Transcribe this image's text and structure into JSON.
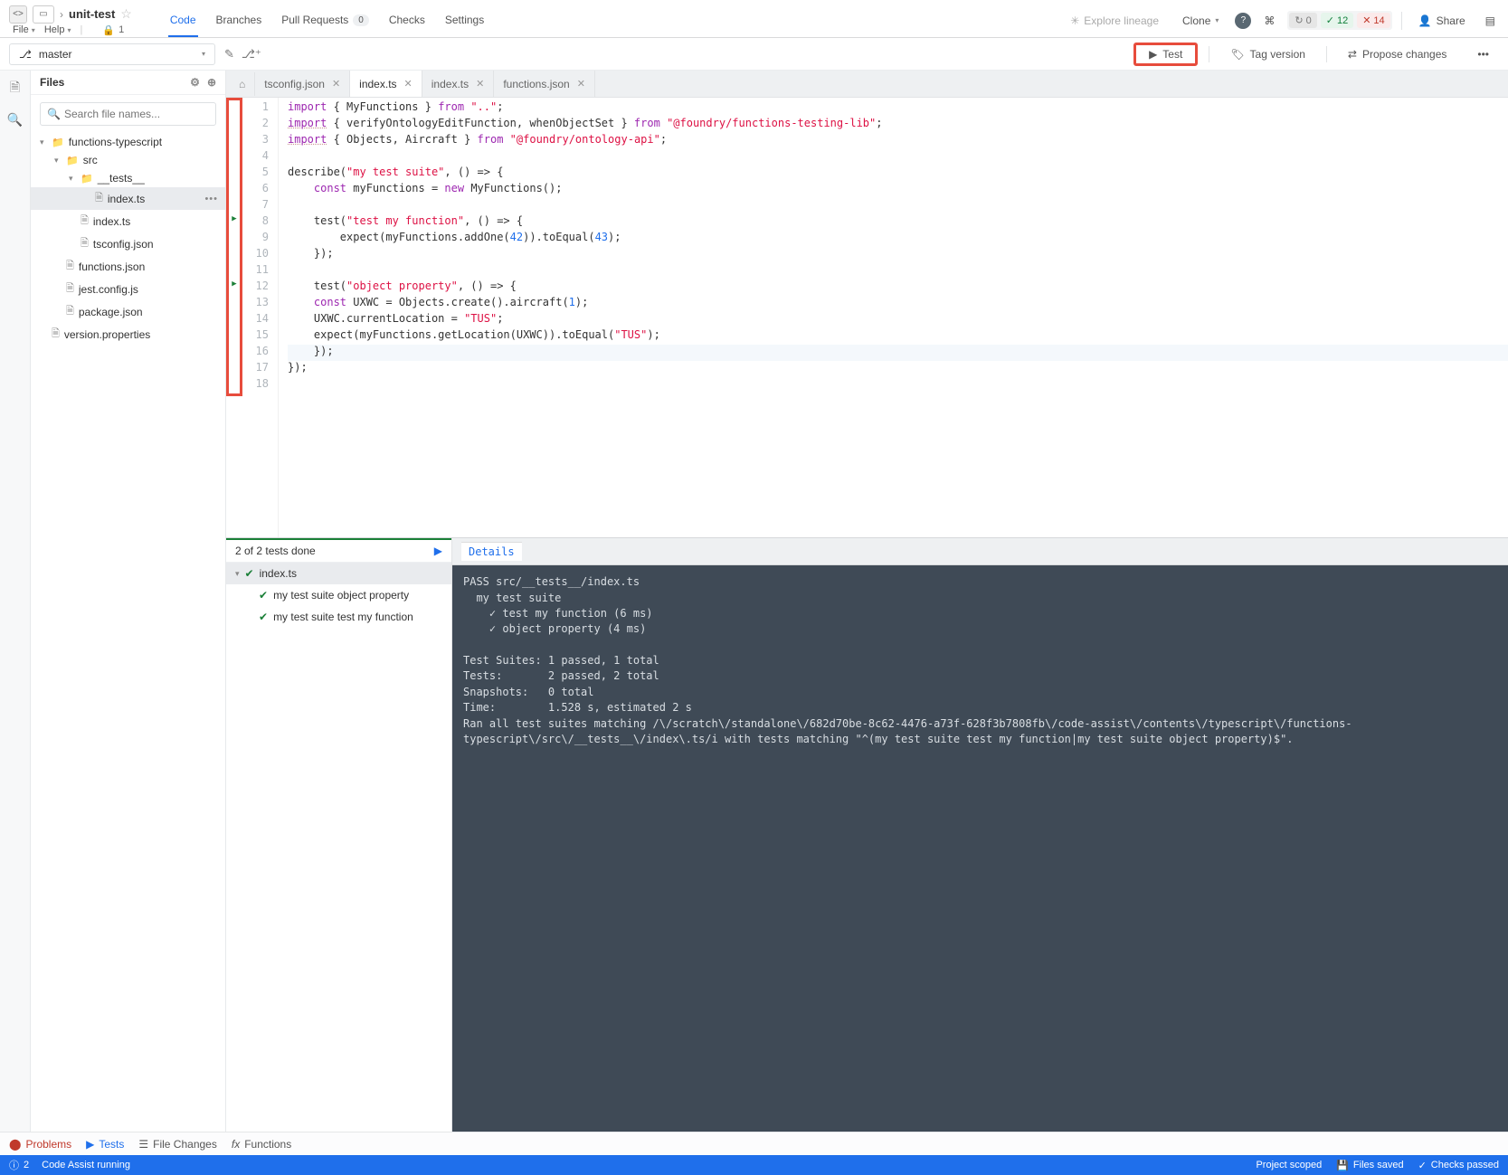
{
  "header": {
    "breadcrumb_prefix": "> ",
    "title": "unit-test",
    "file_menu": "File",
    "help_menu": "Help",
    "lock_owner": "1",
    "nav": {
      "code": "Code",
      "branches": "Branches",
      "pull_requests": "Pull Requests",
      "pr_count": "0",
      "checks": "Checks",
      "settings": "Settings"
    },
    "right": {
      "explore": "Explore lineage",
      "clone": "Clone",
      "stat_sync": "0",
      "stat_pass": "12",
      "stat_fail": "14",
      "share": "Share"
    }
  },
  "subheader": {
    "branch": "master",
    "test": "Test",
    "tag_version": "Tag version",
    "propose": "Propose changes"
  },
  "sidebar": {
    "title": "Files",
    "search_placeholder": "Search file names...",
    "tree": [
      {
        "depth": 0,
        "type": "folder",
        "open": true,
        "name": "functions-typescript"
      },
      {
        "depth": 1,
        "type": "folder",
        "open": true,
        "name": "src"
      },
      {
        "depth": 2,
        "type": "folder",
        "open": true,
        "name": "__tests__"
      },
      {
        "depth": 3,
        "type": "file",
        "name": "index.ts",
        "selected": true
      },
      {
        "depth": 2,
        "type": "file",
        "name": "index.ts"
      },
      {
        "depth": 2,
        "type": "file",
        "name": "tsconfig.json"
      },
      {
        "depth": 1,
        "type": "file",
        "name": "functions.json"
      },
      {
        "depth": 1,
        "type": "file",
        "name": "jest.config.js"
      },
      {
        "depth": 1,
        "type": "file",
        "name": "package.json"
      },
      {
        "depth": 0,
        "type": "file",
        "name": "version.properties"
      }
    ]
  },
  "tabs": [
    {
      "name": "tsconfig.json",
      "active": false
    },
    {
      "name": "index.ts",
      "active": true
    },
    {
      "name": "index.ts",
      "active": false
    },
    {
      "name": "functions.json",
      "active": false
    }
  ],
  "code": {
    "lines": [
      {
        "n": 1,
        "html": "<span class='kw'>import</span> { MyFunctions } <span class='kw'>from</span> <span class='str'>\"..\"</span>;"
      },
      {
        "n": 2,
        "html": "<span class='imp'>import</span> { verifyOntologyEditFunction, whenObjectSet } <span class='kw'>from</span> <span class='str'>\"@foundry/functions-testing-lib\"</span>;"
      },
      {
        "n": 3,
        "html": "<span class='imp'>import</span> { Objects, Aircraft } <span class='kw'>from</span> <span class='str'>\"@foundry/ontology-api\"</span>;"
      },
      {
        "n": 4,
        "html": ""
      },
      {
        "n": 5,
        "html": "describe(<span class='str'>\"my test suite\"</span>, () =&gt; {"
      },
      {
        "n": 6,
        "html": "    <span class='kw'>const</span> myFunctions = <span class='new'>new</span> MyFunctions();"
      },
      {
        "n": 7,
        "html": ""
      },
      {
        "n": 8,
        "run": true,
        "html": "    test(<span class='str'>\"test my function\"</span>, () =&gt; {"
      },
      {
        "n": 9,
        "html": "        expect(myFunctions.addOne(<span class='num'>42</span>)).toEqual(<span class='num'>43</span>);"
      },
      {
        "n": 10,
        "html": "    });"
      },
      {
        "n": 11,
        "html": ""
      },
      {
        "n": 12,
        "run": true,
        "html": "    test(<span class='str'>\"object property\"</span>, () =&gt; {"
      },
      {
        "n": 13,
        "html": "    <span class='kw'>const</span> UXWC = Objects.create().aircraft(<span class='num'>1</span>);"
      },
      {
        "n": 14,
        "html": "    UXWC.currentLocation = <span class='str'>\"TUS\"</span>;"
      },
      {
        "n": 15,
        "html": "    expect(myFunctions.getLocation(UXWC)).toEqual(<span class='str'>\"TUS\"</span>);"
      },
      {
        "n": 16,
        "hl": true,
        "html": "    });"
      },
      {
        "n": 17,
        "html": "});"
      },
      {
        "n": 18,
        "html": ""
      }
    ]
  },
  "tests": {
    "summary": "2 of 2 tests done",
    "file": "index.ts",
    "items": [
      "my test suite object property",
      "my test suite test my function"
    ],
    "details_tab": "Details",
    "console": "PASS src/__tests__/index.ts\n  my test suite\n    ✓ test my function (6 ms)\n    ✓ object property (4 ms)\n\nTest Suites: 1 passed, 1 total\nTests:       2 passed, 2 total\nSnapshots:   0 total\nTime:        1.528 s, estimated 2 s\nRan all test suites matching /\\/scratch\\/standalone\\/682d70be-8c62-4476-a73f-628f3b7808fb\\/code-assist\\/contents\\/typescript\\/functions-typescript\\/src\\/__tests__\\/index\\.ts/i with tests matching \"^(my test suite test my function|my test suite object property)$\"."
  },
  "bottom": {
    "problems": "Problems",
    "tests": "Tests",
    "file_changes": "File Changes",
    "functions": "Functions"
  },
  "status": {
    "left_count": "2",
    "left_msg": "Code Assist running",
    "scope": "Project scoped",
    "saved": "Files saved",
    "checks": "Checks passed"
  }
}
